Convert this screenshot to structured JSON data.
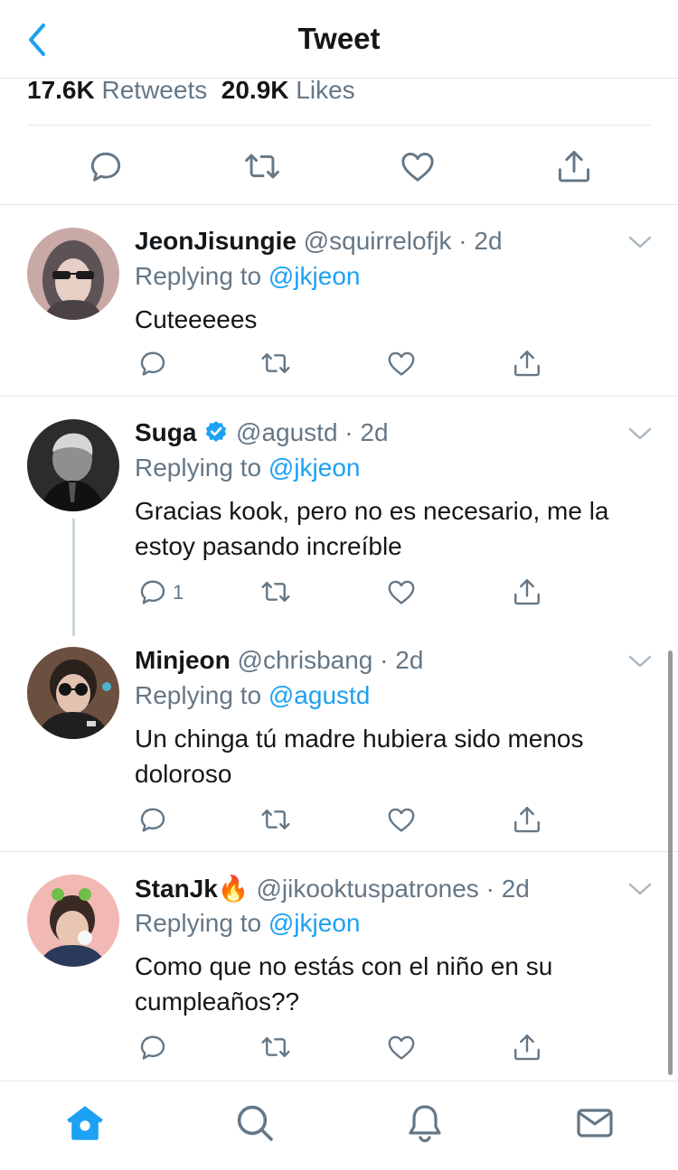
{
  "header": {
    "title": "Tweet"
  },
  "stats": {
    "retweets_count": "17.6K",
    "retweets_label": "Retweets",
    "likes_count": "20.9K",
    "likes_label": "Likes"
  },
  "replies": [
    {
      "name": "JeonJisungie",
      "handle": "@squirrelofjk",
      "time": "2d",
      "replying_prefix": "Replying to",
      "replying_to": "@jkjeon",
      "text": "Cuteeeees",
      "reply_count": ""
    },
    {
      "name": "Suga",
      "verified": true,
      "handle": "@agustd",
      "time": "2d",
      "replying_prefix": "Replying to",
      "replying_to": "@jkjeon",
      "text": "Gracias kook, pero no es necesario, me la estoy pasando increíble",
      "reply_count": "1"
    },
    {
      "name": "Minjeon",
      "handle": "@chrisbang",
      "time": "2d",
      "replying_prefix": "Replying to",
      "replying_to": "@agustd",
      "text": "Un chinga tú madre hubiera sido menos doloroso",
      "reply_count": ""
    },
    {
      "name": "StanJk",
      "name_emoji": "🔥",
      "handle": "@jikooktuspatrones",
      "time": "2d",
      "replying_prefix": "Replying to",
      "replying_to": "@jkjeon",
      "text": "Como que no estás con el niño en su cumpleaños??",
      "reply_count": ""
    }
  ],
  "colors": {
    "accent": "#1da1f2",
    "text": "#14171a",
    "secondary": "#657786",
    "border": "#e1e8ed"
  },
  "icons": [
    "back-chevron-icon",
    "reply-icon",
    "retweet-icon",
    "like-icon",
    "share-icon",
    "caret-down-icon",
    "verified-badge-icon",
    "home-icon",
    "search-icon",
    "notifications-icon",
    "messages-icon"
  ]
}
